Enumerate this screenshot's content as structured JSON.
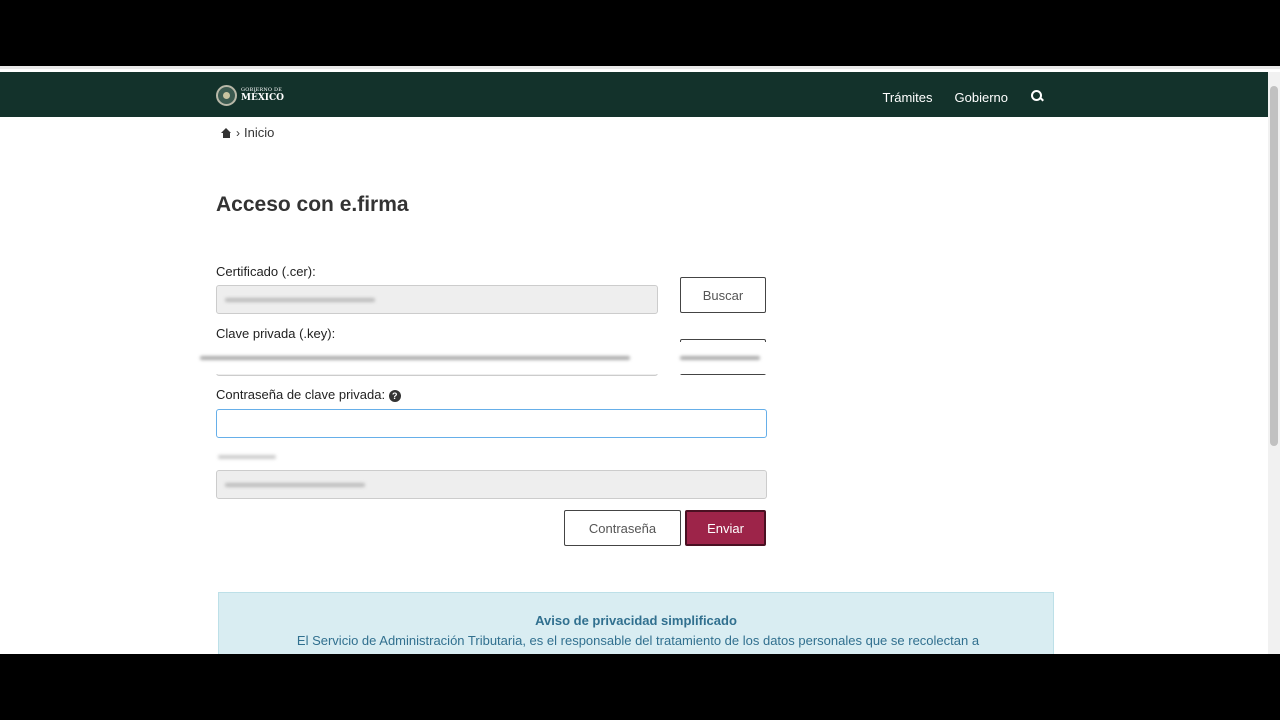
{
  "header": {
    "logo_small": "GOBIERNO DE",
    "logo_big": "MÉXICO",
    "nav": [
      "Trámites",
      "Gobierno"
    ]
  },
  "breadcrumb": {
    "home": "Inicio"
  },
  "page": {
    "title": "Acceso con e.firma"
  },
  "form": {
    "cert_label": "Certificado (.cer):",
    "key_label": "Clave privada (.key):",
    "password_label": "Contraseña de clave privada:",
    "help_glyph": "?",
    "search_button": "Buscar",
    "password_button": "Contraseña",
    "submit_button": "Enviar"
  },
  "notice": {
    "title": "Aviso de privacidad simplificado",
    "body": "El Servicio de Administración Tributaria, es el responsable del tratamiento de los datos personales que se recolectan a"
  },
  "colors": {
    "header_bg": "#13322b",
    "primary": "#9d2449",
    "notice_bg": "#d9edf2",
    "notice_text": "#31708f"
  }
}
